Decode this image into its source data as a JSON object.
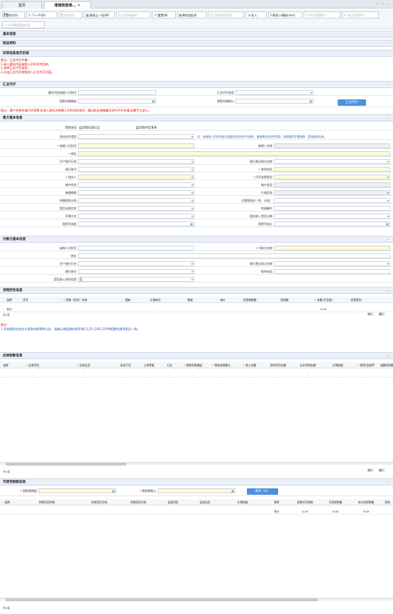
{
  "tabs": [
    {
      "label": "首页"
    },
    {
      "label": "增值税普通..."
    }
  ],
  "toolbar": {
    "row1": [
      {
        "icon": "💾",
        "label": "保存(S)",
        "dis": false
      },
      {
        "icon": "↻",
        "label": "下一户(D)",
        "dis": false
      },
      {
        "icon": "🗑",
        "label": "作废(Q)",
        "dis": true
      },
      {
        "icon": "▦",
        "label": "复制上一张(M)",
        "dis": false
      },
      {
        "icon": "⎙",
        "label": "打印单据(E)",
        "dis": true
      },
      {
        "icon": "↺",
        "label": "重置(B)",
        "dis": false
      },
      {
        "icon": "",
        "label": "查询附加信息",
        "dis": false
      },
      {
        "icon": "⎙",
        "label": "打印完税证明",
        "dis": true
      },
      {
        "icon": "⇲",
        "label": "导入",
        "dis": false
      },
      {
        "icon": "",
        "label": "下载导入模板(xml)",
        "dis": false
      },
      {
        "icon": "⊖",
        "label": "不予受理(V)",
        "dis": true
      },
      {
        "icon": "✔",
        "label": "补正内容(K)",
        "dis": true
      }
    ],
    "print_receipt": "打印受理回执(Q)"
  },
  "sections": {
    "basic": "基本信息",
    "attach": "附送资料",
    "abnormal": "异常信息显示区域",
    "summary": "汇总代开",
    "seller": "售方基本信息",
    "buyer": "付款方基本信息",
    "goods": "货物劳务信息",
    "tax": "应纳税款信息",
    "deduct": "可使用税款信息"
  },
  "notices": {
    "summary_tip": "提示：汇总代开步骤：",
    "step1": "1.录入委托代征纳税人识别号并回车；",
    "step2": "2.选择汇总代开类型；",
    "step3": "3.点击汇总代开按钮进入汇总代开页面。",
    "warn": "提示：客户交易申请代开发票,在录入表应方纳税人识别号回车后，通过前台调查编号进行代开申请,无需手工录入。",
    "goods_tip1": "提示：",
    "goods_tip2": "1.开纳税款信息应与提取的原票种认定，请确认增值税的税率和CS_GY_DLB_ZSPM配置的税率是否一致。"
  },
  "summary_form": {
    "agent_id": "委托代征纳税人识别号",
    "summary_type": "汇总代开类型",
    "period_start": "税款所属期起",
    "period_end": "税款所属期止",
    "btn": "汇总代开"
  },
  "seller_form": {
    "extract_mode": "提取选项",
    "opt1": "提取优惠认定",
    "opt2": "提取特定套餐",
    "id_type": "身份证件类型",
    "id_note": "注：自纳税人识别号或大陆居民身份证件号码时，请选择身份证件类型，其他情况不需选择，否则查询无效。",
    "taxpayer_id": "纳税人识别号",
    "taxpayer_name": "纳税人名称",
    "address": "地址",
    "bank": "开户银行行别",
    "bank_branch": "银行营业网点名称",
    "account": "银行账号",
    "phone": "联系电话",
    "handler": "经办人",
    "invoice_type": "代开发票类型",
    "town": "城乡性质",
    "town2": "城乡类型",
    "tax_period": "纳税期限",
    "district": "行政区划",
    "tax_office": "所属税务分局",
    "tax_authority": "主管税务所（科、分局）",
    "is_tax_seal": "是否出租住房",
    "house_no": "房源编号",
    "invoice_method": "开票方式",
    "rent_income": "租金收入是否分摊",
    "rent_start": "租赁开始起",
    "rent_end": "租赁开始止"
  },
  "buyer_form": {
    "taxpayer_id": "纳税人识别号",
    "payer_name": "付款方名称",
    "address": "地址",
    "bank": "开户银行行别",
    "bank_branch": "银行营业网点名称",
    "account": "银行账号",
    "phone": "联系电话",
    "is_import": "是否录入进项信息",
    "is_import_val": "否"
  },
  "goods_table": {
    "headers": [
      "选择",
      "序号",
      "货物（劳务）名称",
      "规格",
      "计量单位",
      "数量",
      "单价",
      "含税销售额",
      "扣除额",
      "金额(不含税)",
      "经营类别"
    ],
    "row": [
      "合计",
      "",
      "-",
      "",
      "-",
      "",
      "",
      "",
      "",
      "0.00",
      "-"
    ],
    "count": "共0条",
    "add": "增行",
    "del": "删行"
  },
  "tax_table": {
    "headers": [
      "选择",
      "征收项目",
      "征收品目",
      "征收子目",
      "土地等级",
      "行业",
      "税款所属期起",
      "税款所属期止",
      "收入总额",
      "扣除项目金额",
      "允许扣除金额",
      "计税依据",
      "税率/征收率",
      "速算扣除数"
    ],
    "count": "共0条",
    "add": "增行",
    "del": "删行"
  },
  "deduct_form": {
    "start": "税款属期起",
    "end": "税款属期止",
    "query": "查询（Q）",
    "headers": [
      "选择",
      "完税凭证种类",
      "完税凭证字轨",
      "完税凭证号码",
      "征收项目",
      "征收品目",
      "计税依据",
      "税率",
      "发票代开税款",
      "可扣除税额",
      "本次扣除税额",
      "扣除"
    ],
    "row": [
      "-",
      "-",
      "",
      "-",
      "-",
      "-",
      "-",
      "合计",
      "0.00",
      "0.00",
      "0.00",
      ""
    ],
    "count": "共0条"
  }
}
